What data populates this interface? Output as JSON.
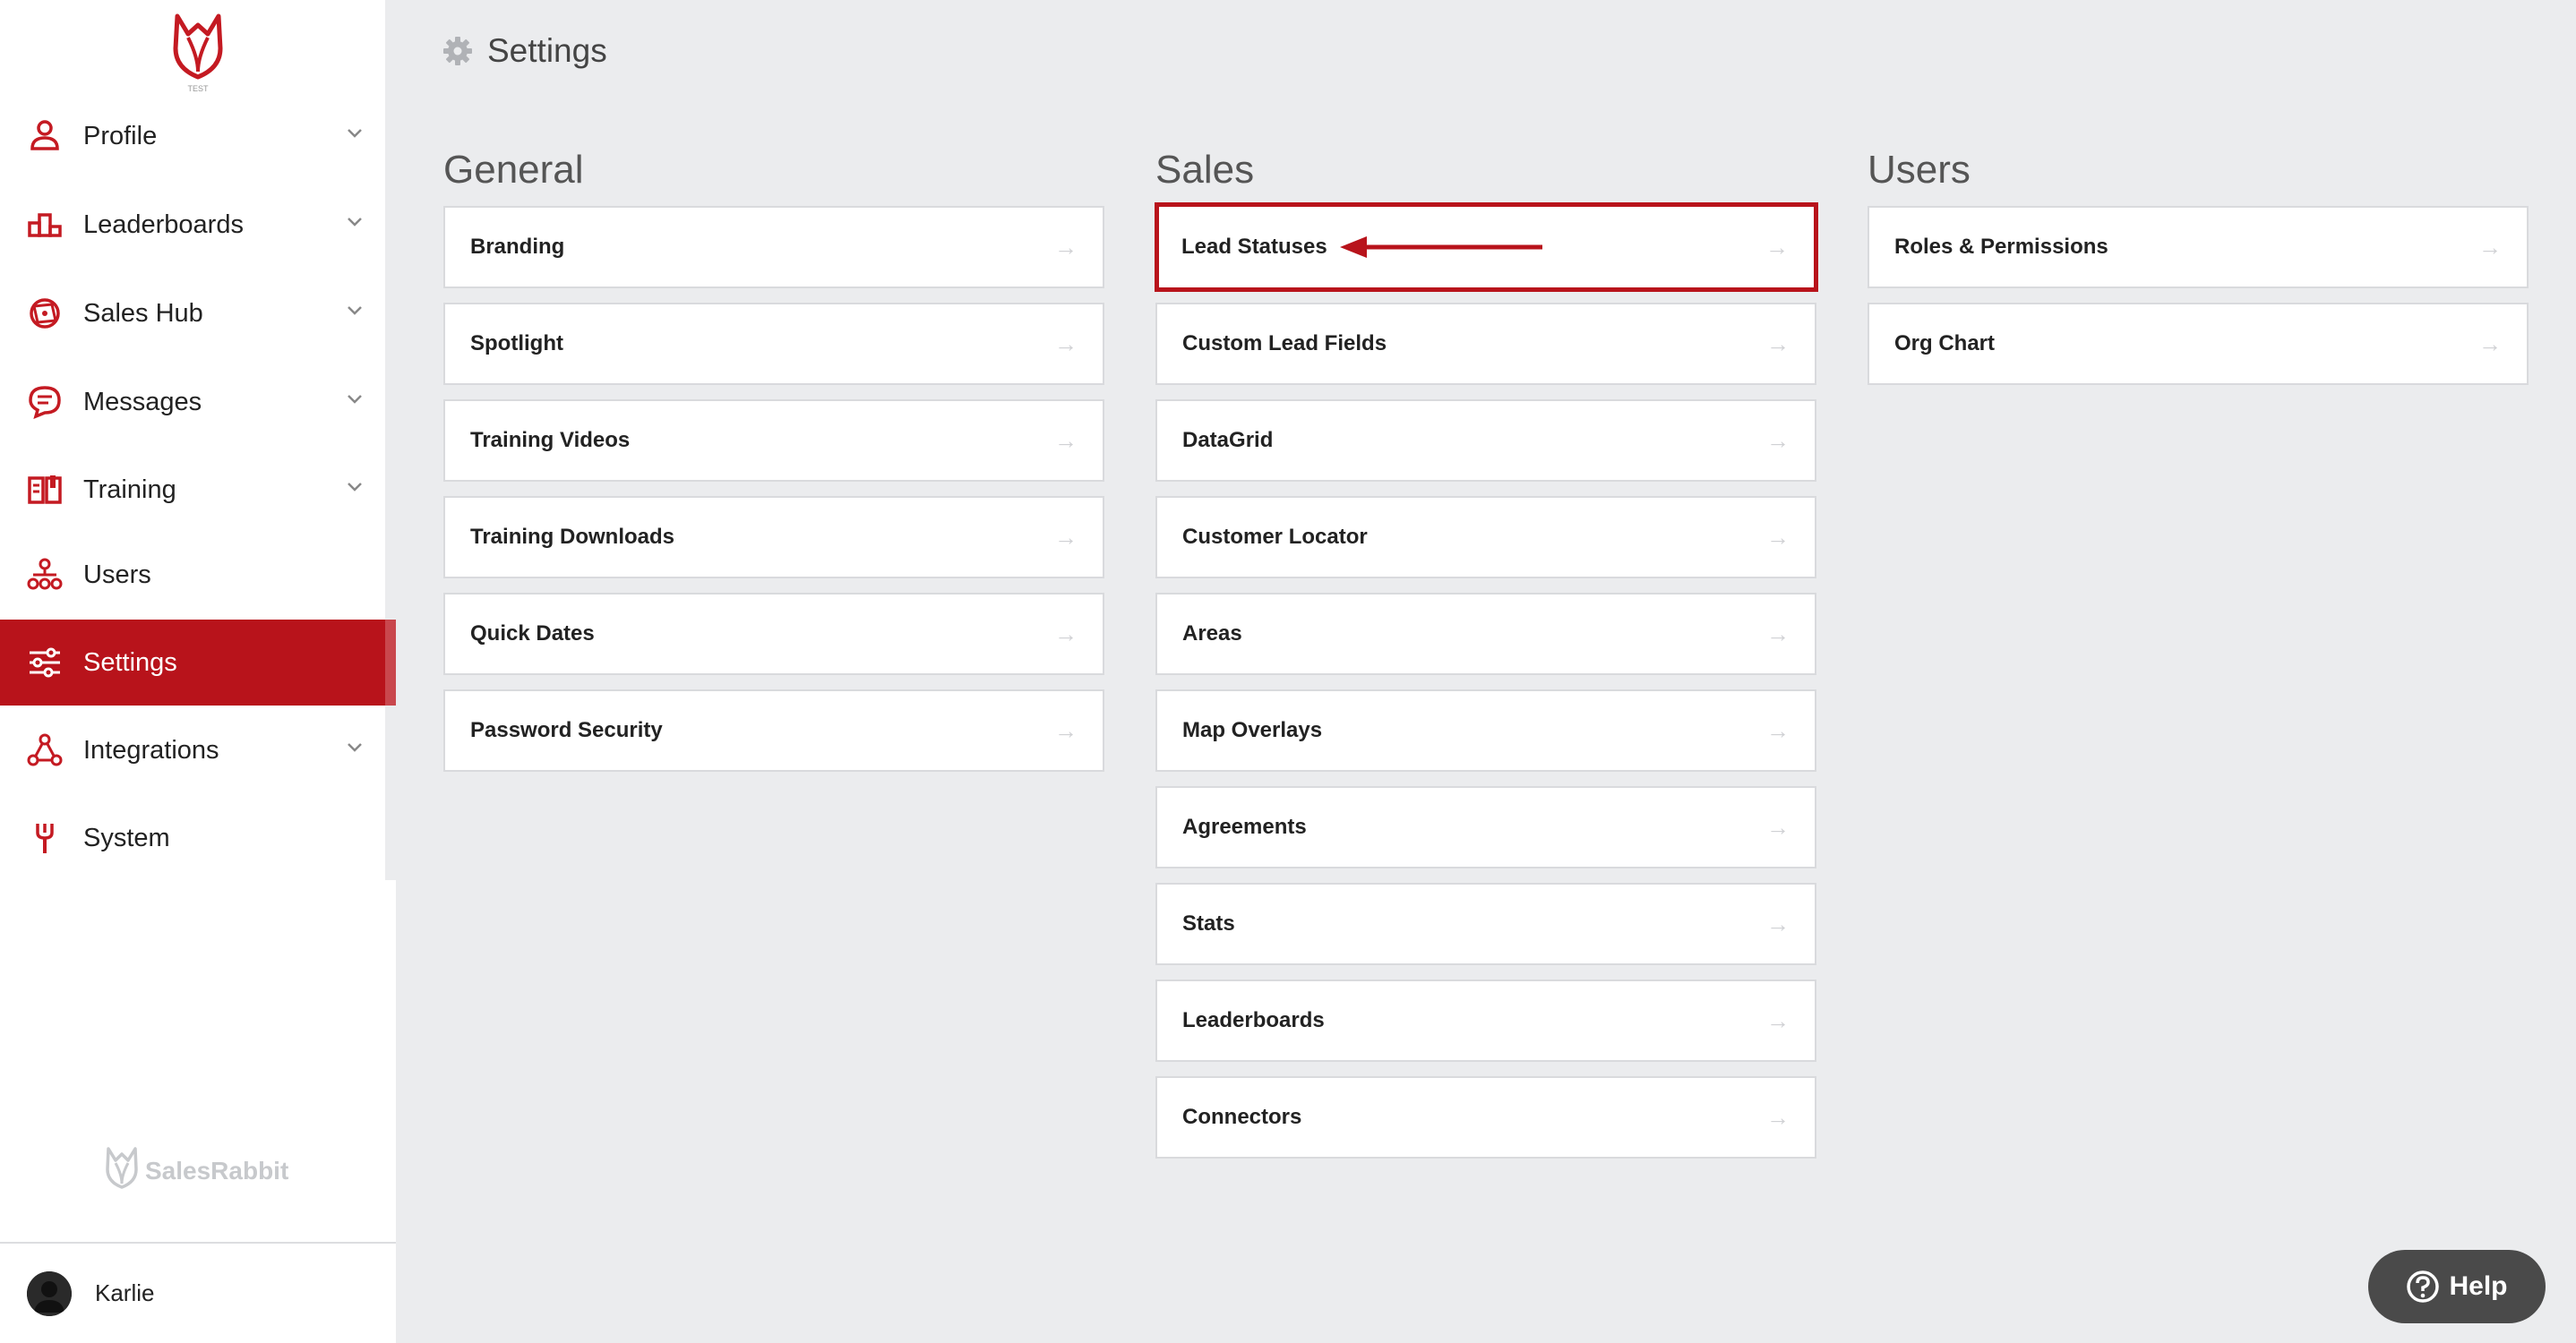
{
  "sidebar": {
    "logo_sub": "TEST",
    "items": [
      {
        "label": "Profile",
        "icon": "person-icon",
        "chevron": true
      },
      {
        "label": "Leaderboards",
        "icon": "podium-icon",
        "chevron": true
      },
      {
        "label": "Sales Hub",
        "icon": "network-globe-icon",
        "chevron": true
      },
      {
        "label": "Messages",
        "icon": "chat-bubble-icon",
        "chevron": true
      },
      {
        "label": "Training",
        "icon": "book-icon",
        "chevron": true
      },
      {
        "label": "Users",
        "icon": "org-chart-icon",
        "chevron": false
      },
      {
        "label": "Settings",
        "icon": "sliders-icon",
        "chevron": false,
        "active": true
      },
      {
        "label": "Integrations",
        "icon": "integrations-icon",
        "chevron": true
      },
      {
        "label": "System",
        "icon": "wrench-icon",
        "chevron": false
      }
    ],
    "brand_name": "SalesRabbit",
    "user_name": "Karlie"
  },
  "header": {
    "title": "Settings"
  },
  "columns": [
    {
      "title": "General",
      "items": [
        "Branding",
        "Spotlight",
        "Training Videos",
        "Training Downloads",
        "Quick Dates",
        "Password Security"
      ]
    },
    {
      "title": "Sales",
      "items": [
        "Lead Statuses",
        "Custom Lead Fields",
        "DataGrid",
        "Customer Locator",
        "Areas",
        "Map Overlays",
        "Agreements",
        "Stats",
        "Leaderboards",
        "Connectors"
      ]
    },
    {
      "title": "Users",
      "items": [
        "Roles & Permissions",
        "Org Chart"
      ]
    }
  ],
  "arrow_glyph": "→",
  "help": {
    "label": "Help"
  },
  "colors": {
    "accent": "#b8131b",
    "background": "#ebecee"
  }
}
